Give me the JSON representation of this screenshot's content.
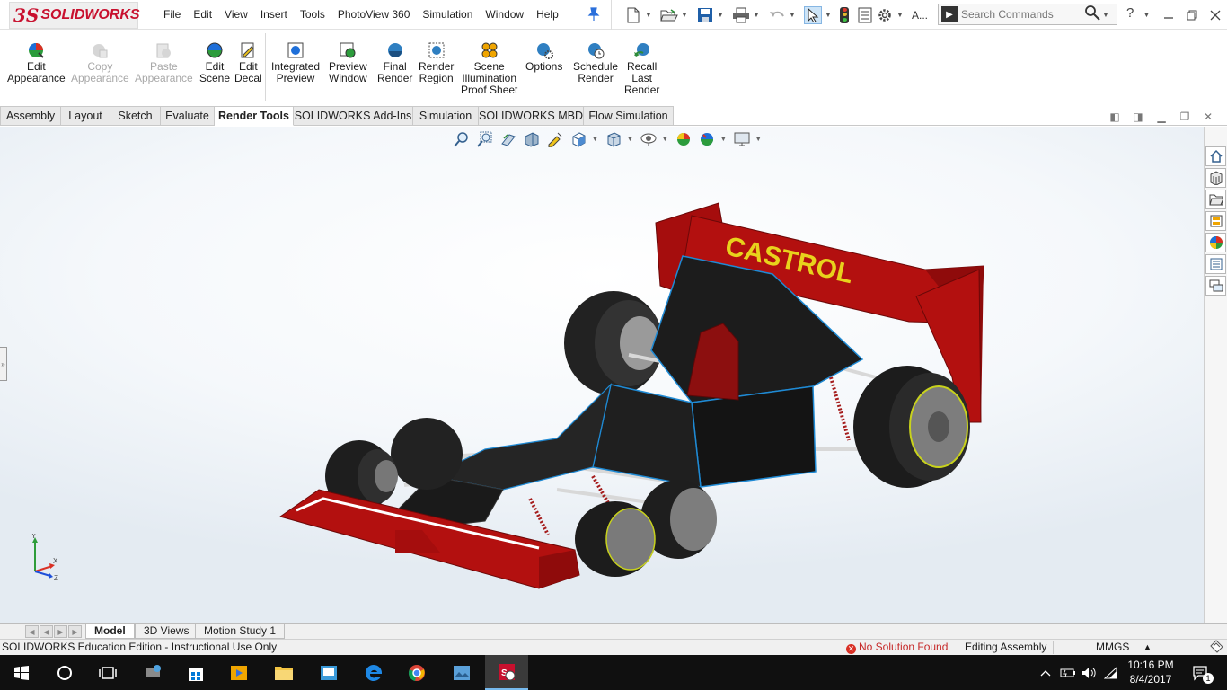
{
  "app": {
    "logo_mark": "3S",
    "logo_text": "SOLIDWORKS"
  },
  "menu": [
    "File",
    "Edit",
    "View",
    "Insert",
    "Tools",
    "PhotoView 360",
    "Simulation",
    "Window",
    "Help"
  ],
  "toolbar": {
    "toolbox_label": "A...",
    "search_placeholder": "Search Commands",
    "help_label": "?"
  },
  "ribbon": {
    "buttons": [
      {
        "label1": "Edit",
        "label2": "Appearance",
        "label3": "",
        "enabled": true
      },
      {
        "label1": "Copy",
        "label2": "Appearance",
        "label3": "",
        "enabled": false
      },
      {
        "label1": "Paste",
        "label2": "Appearance",
        "label3": "",
        "enabled": false
      },
      {
        "label1": "Edit",
        "label2": "Scene",
        "label3": "",
        "enabled": true
      },
      {
        "label1": "Edit",
        "label2": "Decal",
        "label3": "",
        "enabled": true
      },
      {
        "label1": "Integrated",
        "label2": "Preview",
        "label3": "",
        "enabled": true
      },
      {
        "label1": "Preview",
        "label2": "Window",
        "label3": "",
        "enabled": true
      },
      {
        "label1": "Final",
        "label2": "Render",
        "label3": "",
        "enabled": true
      },
      {
        "label1": "Render",
        "label2": "Region",
        "label3": "",
        "enabled": true
      },
      {
        "label1": "Scene",
        "label2": "Illumination",
        "label3": "Proof Sheet",
        "enabled": true
      },
      {
        "label1": "Options",
        "label2": "",
        "label3": "",
        "enabled": true
      },
      {
        "label1": "Schedule",
        "label2": "Render",
        "label3": "",
        "enabled": true
      },
      {
        "label1": "Recall",
        "label2": "Last",
        "label3": "Render",
        "enabled": true
      }
    ]
  },
  "tabs": [
    {
      "label": "Assembly",
      "active": false
    },
    {
      "label": "Layout",
      "active": false
    },
    {
      "label": "Sketch",
      "active": false
    },
    {
      "label": "Evaluate",
      "active": false
    },
    {
      "label": "Render Tools",
      "active": true
    },
    {
      "label": "SOLIDWORKS Add-Ins",
      "active": false
    },
    {
      "label": "Simulation",
      "active": false
    },
    {
      "label": "SOLIDWORKS MBD",
      "active": false
    },
    {
      "label": "Flow Simulation",
      "active": false
    }
  ],
  "model": {
    "wing_text": "CASTROL",
    "triad_axes": {
      "x": "X",
      "y": "Y",
      "z": "Z"
    }
  },
  "bottom_tabs": [
    {
      "label": "Model",
      "active": true
    },
    {
      "label": "3D Views",
      "active": false
    },
    {
      "label": "Motion Study 1",
      "active": false
    }
  ],
  "status": {
    "edition": "SOLIDWORKS Education Edition - Instructional Use Only",
    "solution": "No Solution Found",
    "mode": "Editing Assembly",
    "units": "MMGS",
    "units_arrow": "▲"
  },
  "taskbar": {
    "time": "10:16 PM",
    "date": "8/4/2017",
    "notifications": "1"
  },
  "colors": {
    "brand": "#c8102e",
    "car_red": "#b3100f",
    "selection_blue": "#1f8ad4",
    "taskbar": "#101010"
  }
}
